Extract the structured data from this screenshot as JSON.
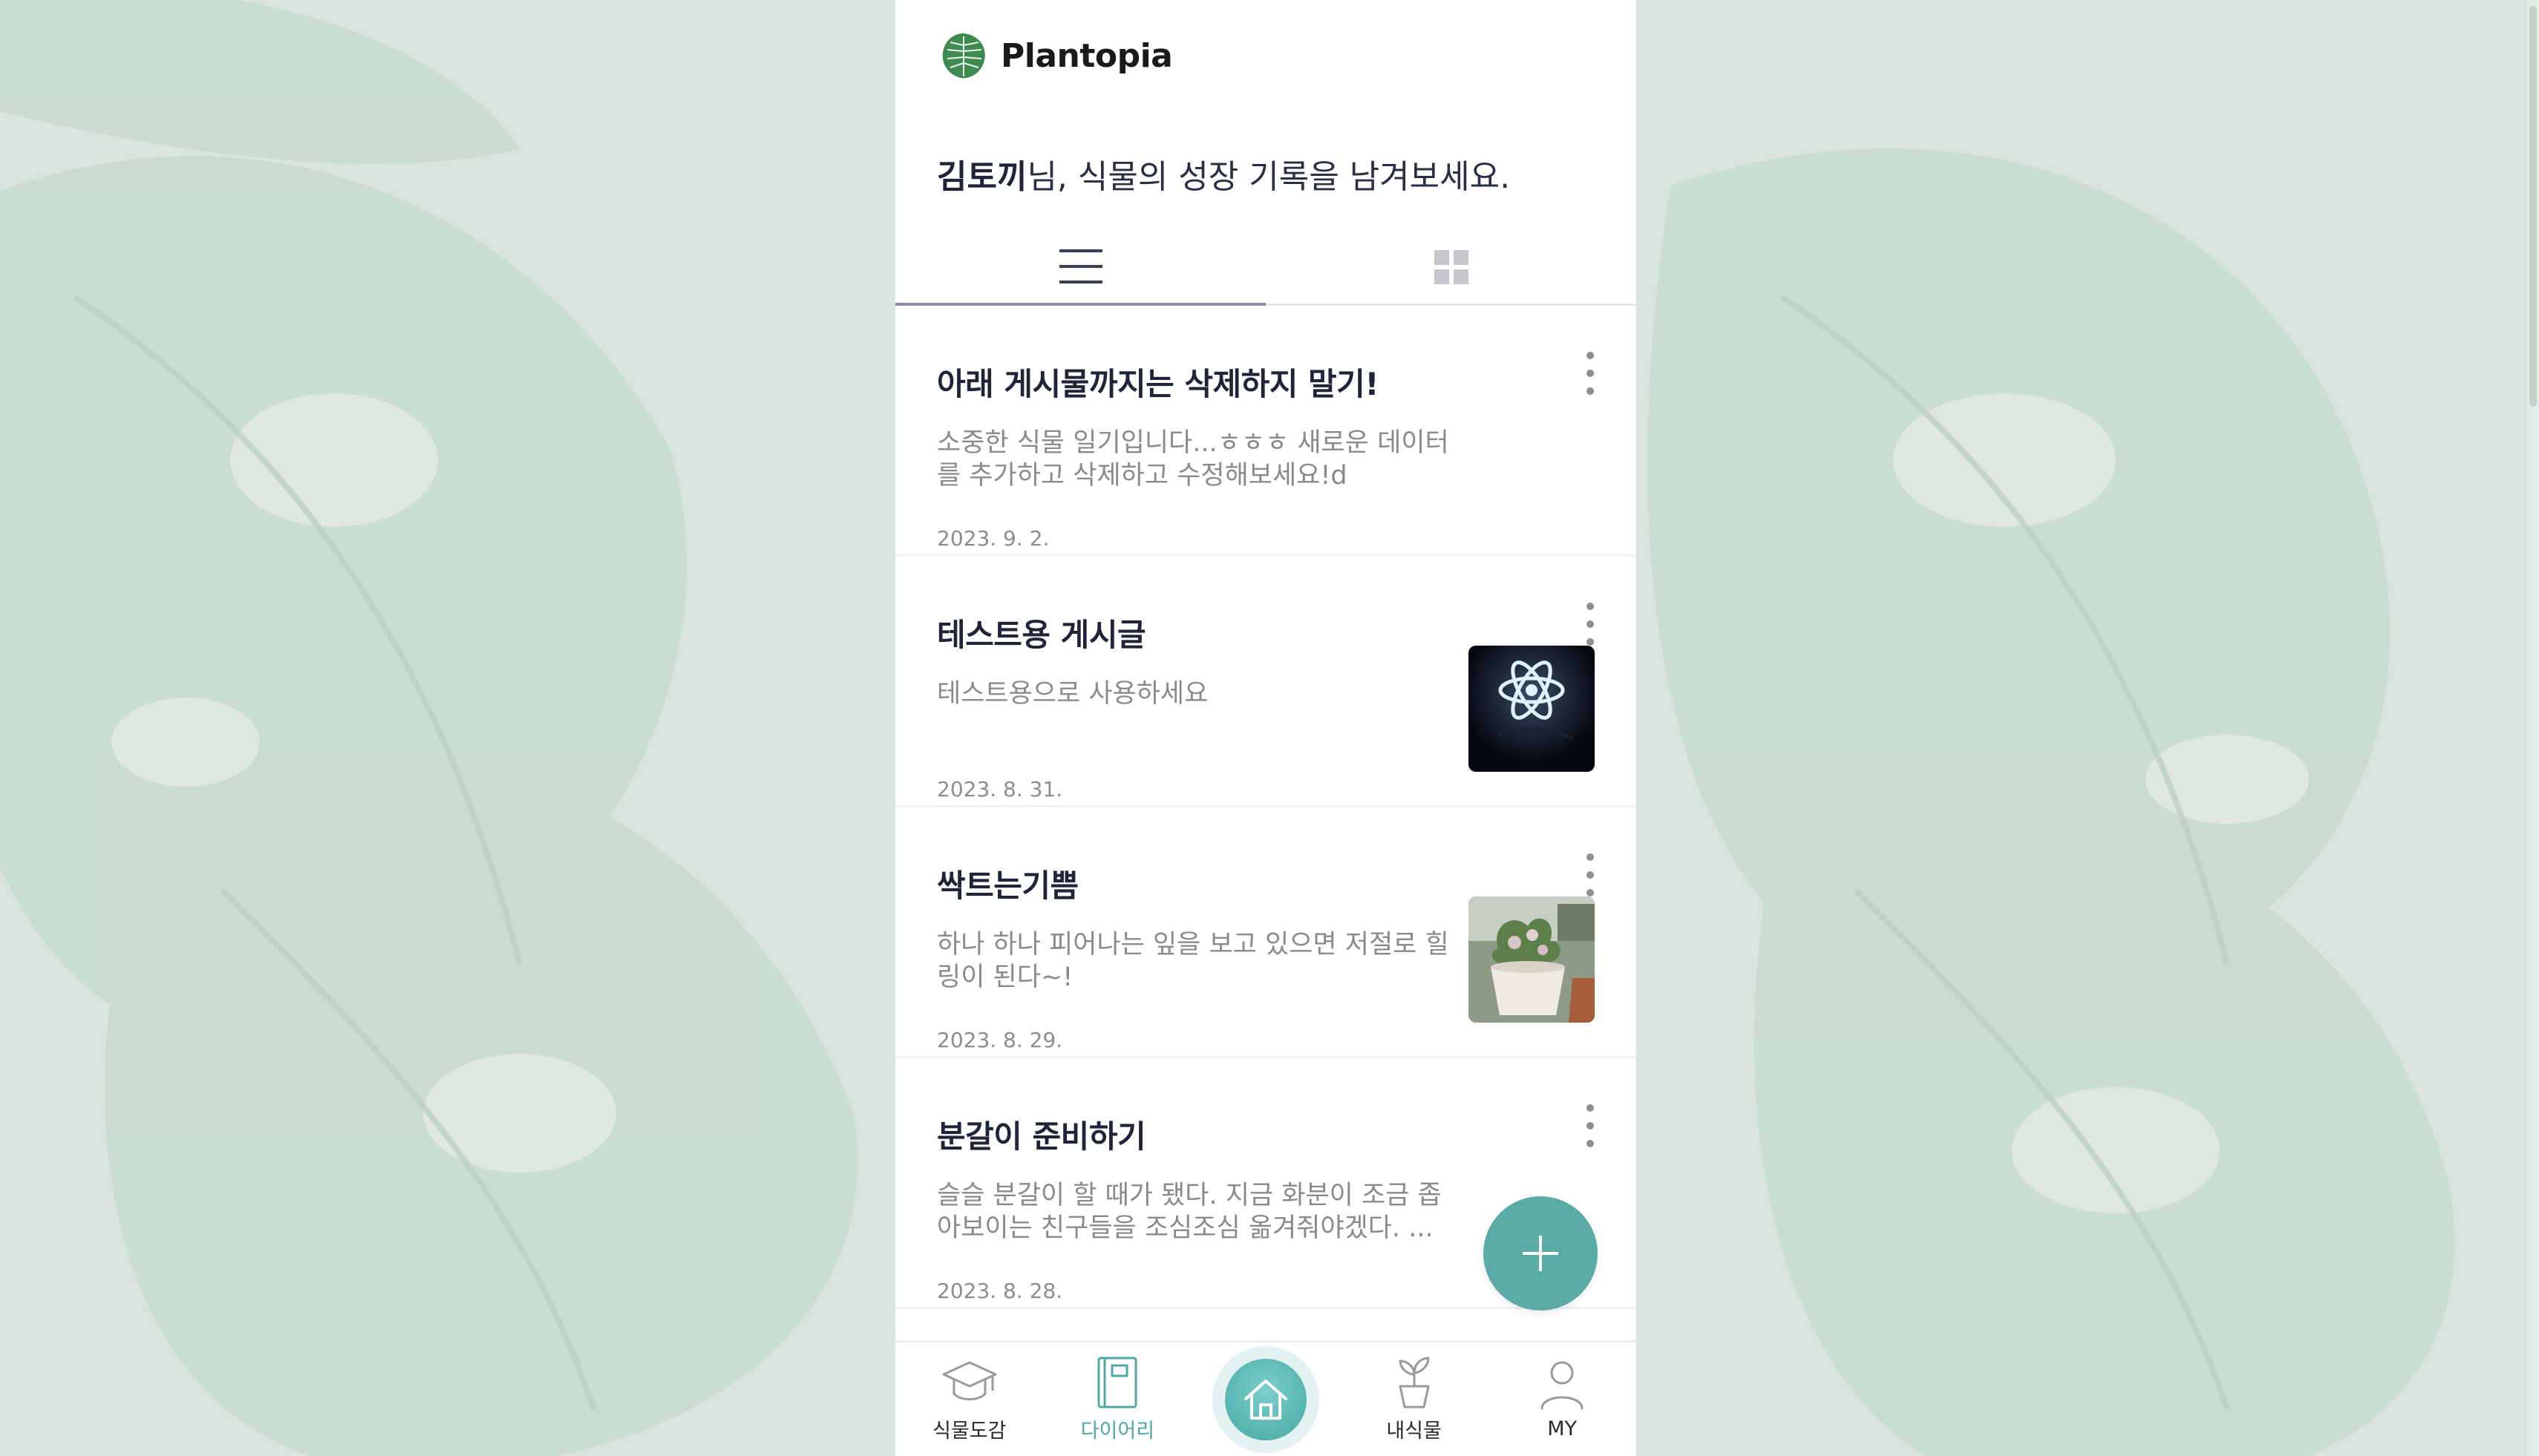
{
  "app": {
    "brand": "Plantopia"
  },
  "greeting": {
    "name": "김토끼",
    "suffix": "님, 식물의 성장 기록을 남겨보세요."
  },
  "view_tabs": [
    {
      "icon": "list-icon",
      "active": true
    },
    {
      "icon": "grid-icon",
      "active": false
    }
  ],
  "posts": [
    {
      "title": "아래 게시물까지는 삭제하지 말기!",
      "body": "소중한 식물 일기입니다...ㅎㅎㅎ 새로운 데이터를 추가하고 삭제하고 수정해보세요!d",
      "date": "2023. 9. 2.",
      "thumbnail": null
    },
    {
      "title": "테스트용 게시글",
      "body": "테스트용으로 사용하세요",
      "date": "2023. 8. 31.",
      "thumbnail": "react-logo-image"
    },
    {
      "title": "싹트는기쁨",
      "body": "하나 하나 피어나는 잎을 보고 있으면 저절로 힐링이 된다~!",
      "date": "2023. 8. 29.",
      "thumbnail": "plant-pot-photo"
    },
    {
      "title": "분갈이 준비하기",
      "body": "슬슬 분갈이 할 때가 됐다. 지금 화분이 조금 좁아보이는 친구들을 조심조심 옮겨줘야겠다. ...",
      "date": "2023. 8. 28.",
      "thumbnail": null
    }
  ],
  "fab": {
    "icon": "plus-icon"
  },
  "bottom_nav": [
    {
      "label": "식물도감",
      "icon": "graduation-cap-icon",
      "active": false
    },
    {
      "label": "다이어리",
      "icon": "notebook-icon",
      "active": true
    },
    {
      "label": "",
      "icon": "home-icon",
      "active": false
    },
    {
      "label": "내식물",
      "icon": "potted-plant-icon",
      "active": false
    },
    {
      "label": "MY",
      "icon": "person-icon",
      "active": false
    }
  ],
  "colors": {
    "accent": "#5aaaa6",
    "title": "#1f2438",
    "muted": "#8a8a8a",
    "background": "#d7e3dc"
  }
}
